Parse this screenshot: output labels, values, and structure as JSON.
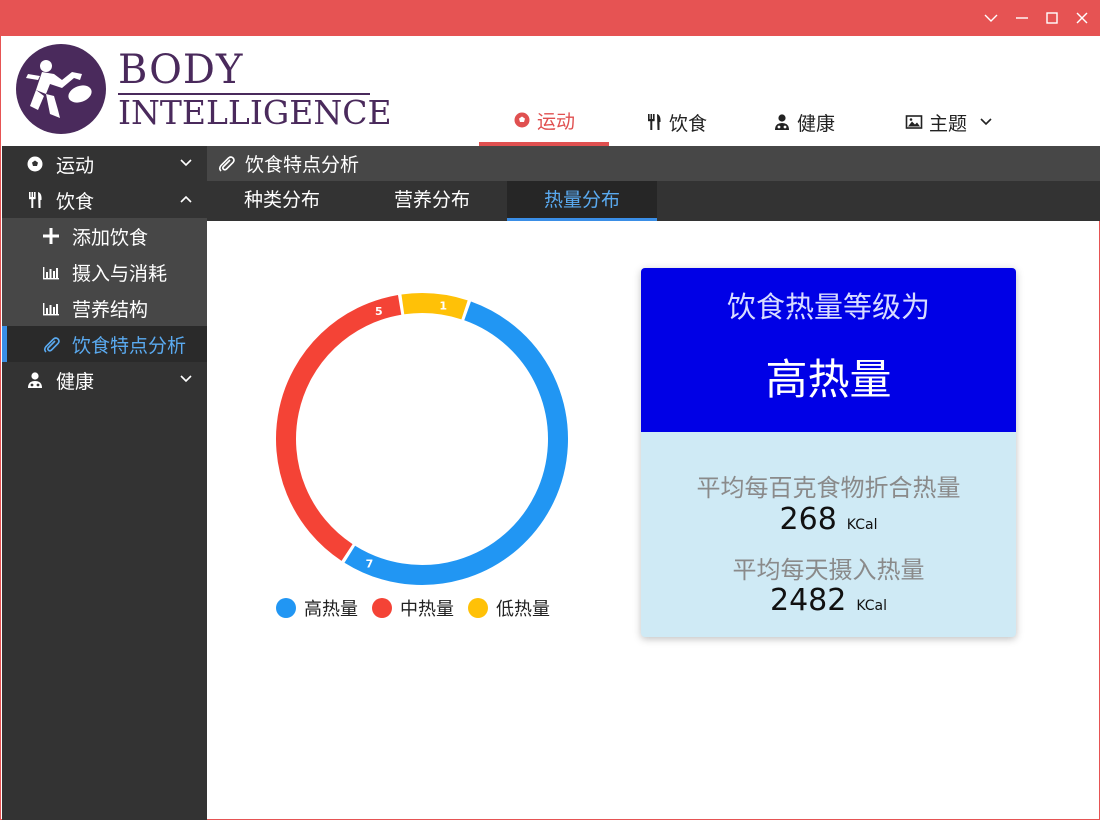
{
  "logo": {
    "line1": "BODY",
    "line2": "INTELLIGENCE"
  },
  "window_controls": [
    {
      "name": "collapse",
      "icon": "chevron-down-icon"
    },
    {
      "name": "minimize",
      "icon": "minimize-icon"
    },
    {
      "name": "maximize",
      "icon": "maximize-icon"
    },
    {
      "name": "close",
      "icon": "close-icon"
    }
  ],
  "topnav": {
    "sport": "运动",
    "diet": "饮食",
    "health": "健康",
    "theme": "主题",
    "active": "sport"
  },
  "sidebar": {
    "sport": "运动",
    "diet": "饮食",
    "add_diet": "添加饮食",
    "intake": "摄入与消耗",
    "nutrition": "营养结构",
    "features": "饮食特点分析",
    "health": "健康"
  },
  "content": {
    "header": "饮食特点分析",
    "tabs": [
      "种类分布",
      "营养分布",
      "热量分布"
    ],
    "active_tab": 2
  },
  "card": {
    "level_label": "饮食热量等级为",
    "level_value": "高热量",
    "avg100_label": "平均每百克食物折合热量",
    "avg100_value": "268",
    "avg100_unit": "KCal",
    "daily_label": "平均每天摄入热量",
    "daily_value": "2482",
    "daily_unit": "KCal"
  },
  "colors": {
    "accent": "#e65353",
    "high": "#2196f3",
    "mid": "#f44336",
    "low": "#ffc107",
    "card_top": "#0000e6",
    "card_bottom": "#cfeaf5"
  },
  "chart_data": {
    "type": "pie",
    "donut": true,
    "legend_position": "bottom",
    "series": [
      {
        "name": "高热量",
        "value": 7,
        "color": "#2196f3"
      },
      {
        "name": "中热量",
        "value": 5,
        "color": "#f44336"
      },
      {
        "name": "低热量",
        "value": 1,
        "color": "#ffc107"
      }
    ]
  }
}
